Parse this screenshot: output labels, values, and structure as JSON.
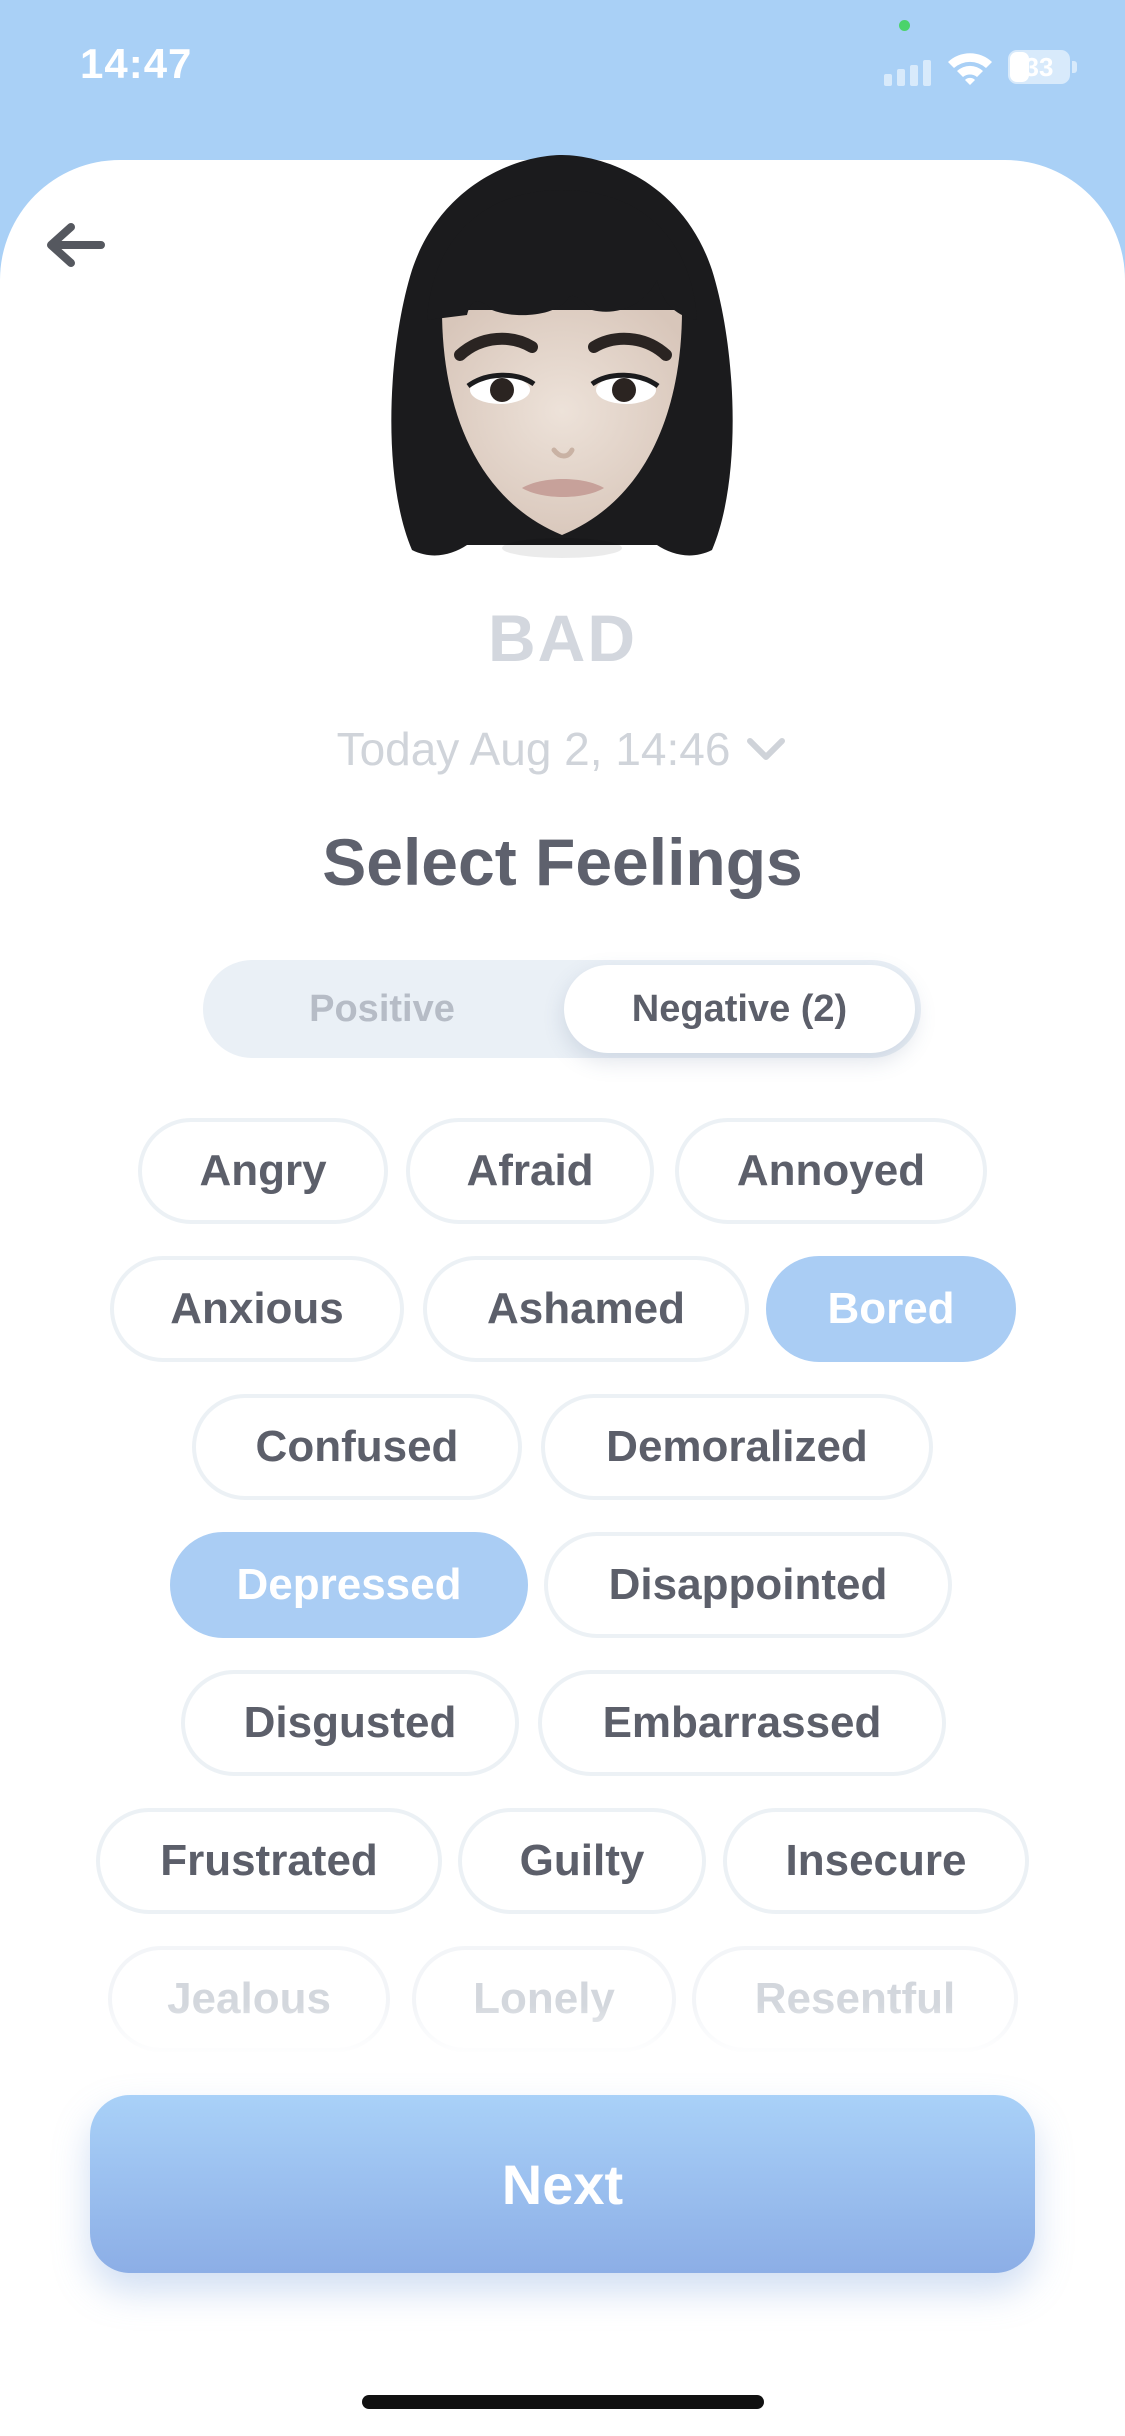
{
  "status_bar": {
    "time": "14:47",
    "battery_level": "33",
    "battery_fraction": 0.33
  },
  "mood": {
    "label": "BAD",
    "date": "Today Aug 2, 14:46"
  },
  "title": "Select Feelings",
  "segments": {
    "positive": "Positive",
    "negative": "Negative (2)",
    "active": "negative"
  },
  "feelings": [
    {
      "label": "Angry",
      "selected": false
    },
    {
      "label": "Afraid",
      "selected": false
    },
    {
      "label": "Annoyed",
      "selected": false
    },
    {
      "label": "Anxious",
      "selected": false
    },
    {
      "label": "Ashamed",
      "selected": false
    },
    {
      "label": "Bored",
      "selected": true
    },
    {
      "label": "Confused",
      "selected": false
    },
    {
      "label": "Demoralized",
      "selected": false
    },
    {
      "label": "Depressed",
      "selected": true
    },
    {
      "label": "Disappointed",
      "selected": false
    },
    {
      "label": "Disgusted",
      "selected": false
    },
    {
      "label": "Embarrassed",
      "selected": false
    },
    {
      "label": "Frustrated",
      "selected": false
    },
    {
      "label": "Guilty",
      "selected": false
    },
    {
      "label": "Insecure",
      "selected": false
    },
    {
      "label": "Jealous",
      "selected": false
    },
    {
      "label": "Lonely",
      "selected": false
    },
    {
      "label": "Resentful",
      "selected": false
    }
  ],
  "next_label": "Next",
  "colors": {
    "accent": "#aacdf4",
    "header_bg": "#a9d0f6",
    "title": "#5e616d"
  },
  "icons": {
    "back": "arrow-left-icon",
    "date_toggle": "chevron-down-icon",
    "avatar": "memoji-avatar"
  }
}
